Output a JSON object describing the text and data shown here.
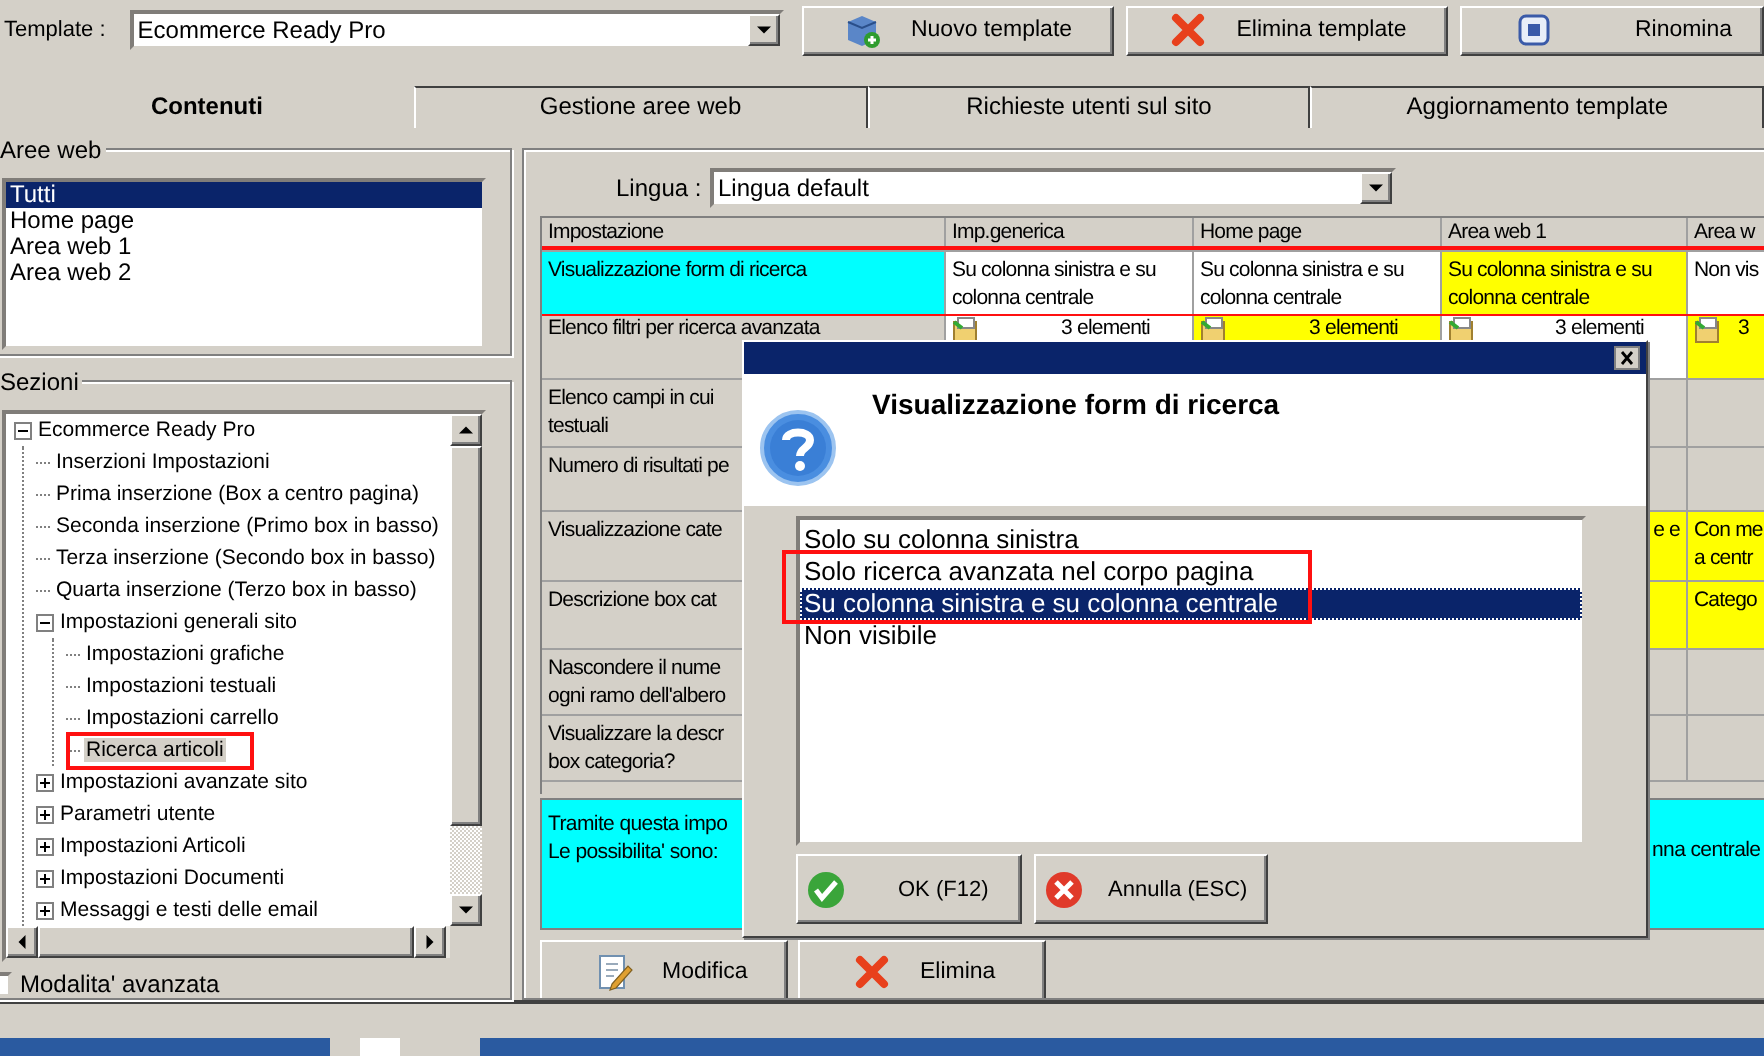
{
  "template": {
    "label": "Template :",
    "value": "Ecommerce Ready Pro"
  },
  "toolbar": [
    {
      "label": "Nuovo template"
    },
    {
      "label": "Elimina template"
    },
    {
      "label": "Rinomina"
    }
  ],
  "tabs": [
    {
      "label": "Contenuti",
      "selected": true
    },
    {
      "label": "Gestione aree web",
      "selected": false
    },
    {
      "label": "Richieste utenti sul sito",
      "selected": false
    },
    {
      "label": "Aggiornamento template",
      "selected": false
    }
  ],
  "aree_web": {
    "title": "Aree web",
    "items": [
      {
        "label": "Tutti",
        "selected": true
      },
      {
        "label": "Home page",
        "selected": false
      },
      {
        "label": "Area web 1",
        "selected": false
      },
      {
        "label": "Area web 2",
        "selected": false
      }
    ]
  },
  "sezioni": {
    "title": "Sezioni",
    "tree": [
      {
        "label": "Ecommerce Ready Pro",
        "expanded": true,
        "selected": false,
        "highlighted": false,
        "children": [
          {
            "label": "Inserzioni Impostazioni",
            "selected": false,
            "highlighted": false
          },
          {
            "label": "Prima inserzione (Box a centro pagina)",
            "selected": false,
            "highlighted": false
          },
          {
            "label": "Seconda inserzione (Primo box in basso)",
            "selected": false,
            "highlighted": false
          },
          {
            "label": "Terza inserzione (Secondo box in basso)",
            "selected": false,
            "highlighted": false
          },
          {
            "label": "Quarta inserzione (Terzo box in basso)",
            "selected": false,
            "highlighted": false
          },
          {
            "label": "Impostazioni generali sito",
            "expanded": true,
            "selected": false,
            "highlighted": false,
            "children": [
              {
                "label": "Impostazioni grafiche",
                "selected": false,
                "highlighted": false
              },
              {
                "label": "Impostazioni testuali",
                "selected": false,
                "highlighted": false
              },
              {
                "label": "Impostazioni carrello",
                "selected": false,
                "highlighted": false
              },
              {
                "label": "Ricerca articoli",
                "selected": true,
                "highlighted": true
              }
            ]
          },
          {
            "label": "Impostazioni avanzate sito",
            "expanded": false,
            "selected": false,
            "highlighted": false
          },
          {
            "label": "Parametri utente",
            "expanded": false,
            "selected": false,
            "highlighted": false
          },
          {
            "label": "Impostazioni Articoli",
            "expanded": false,
            "selected": false,
            "highlighted": false
          },
          {
            "label": "Impostazioni Documenti",
            "expanded": false,
            "selected": false,
            "highlighted": false
          },
          {
            "label": "Messaggi e testi delle email",
            "expanded": false,
            "selected": false,
            "highlighted": false
          }
        ]
      }
    ]
  },
  "advanced_mode": {
    "label": "Modalita' avanzata",
    "checked": false
  },
  "lingua": {
    "label": "Lingua :",
    "value": "Lingua default"
  },
  "grid": {
    "columns": [
      "Impostazione",
      "Imp.generica",
      "Home page",
      "Area web 1",
      "Area w"
    ],
    "rows": [
      {
        "highlighted": true,
        "cells": [
          {
            "text": "Visualizzazione form di ricerca",
            "color": "#00ffff"
          },
          {
            "text": "Su colonna sinistra e su colonna centrale",
            "color": "#ffffff"
          },
          {
            "text": "Su colonna sinistra e su colonna centrale",
            "color": "#ffffff"
          },
          {
            "text": "Su colonna sinistra e su colonna centrale",
            "color": "#ffff00"
          },
          {
            "text": "Non vis",
            "color": "#ffffff"
          }
        ]
      },
      {
        "highlighted": false,
        "cells": [
          {
            "text": "Elenco filtri per ricerca avanzata",
            "color": "#d4d0c8"
          },
          {
            "kind": "list",
            "text": "3 elementi",
            "color": "#ffffff"
          },
          {
            "kind": "list",
            "text": "3 elementi",
            "color": "#ffff00"
          },
          {
            "kind": "list",
            "text": "3 elementi",
            "color": "#ffffff"
          },
          {
            "kind": "list",
            "text": "3",
            "color": "#ffff00"
          }
        ]
      },
      {
        "highlighted": false,
        "cells": [
          {
            "text": "Elenco campi in cui\ntestuali",
            "color": "#d4d0c8"
          },
          null,
          null,
          null,
          null
        ]
      },
      {
        "highlighted": false,
        "cells": [
          {
            "text": "Numero di risultati pe",
            "color": "#d4d0c8"
          },
          null,
          null,
          null,
          null
        ]
      },
      {
        "highlighted": false,
        "cells": [
          {
            "text": "Visualizzazione cate",
            "color": "#d4d0c8"
          },
          null,
          null,
          {
            "text": "e e",
            "color": "#ffff00"
          },
          {
            "text": "Con me\na centr",
            "color": "#ffff00"
          }
        ]
      },
      {
        "highlighted": false,
        "cells": [
          {
            "text": "Descrizione box cat",
            "color": "#d4d0c8"
          },
          null,
          null,
          {
            "color": "#ffff00"
          },
          {
            "text": "Catego",
            "color": "#ffff00"
          }
        ]
      },
      {
        "highlighted": false,
        "cells": [
          {
            "text": "Nascondere il nume\nogni ramo dell'albero",
            "color": "#d4d0c8"
          },
          null,
          null,
          null,
          null
        ]
      },
      {
        "highlighted": false,
        "cells": [
          {
            "text": "Visualizzare la descr\nbox categoria?",
            "color": "#d4d0c8"
          },
          null,
          null,
          null,
          null
        ]
      }
    ]
  },
  "description": {
    "text": "Tramite questa impo\nLe possibilita' sono:",
    "tail": "nna centrale"
  },
  "actions": [
    {
      "label": "Modifica"
    },
    {
      "label": "Elimina"
    }
  ],
  "dialog": {
    "title": "Visualizzazione form di ricerca",
    "options": [
      {
        "label": "Solo su colonna sinistra",
        "selected": false,
        "highlighted": false
      },
      {
        "label": "Solo ricerca avanzata nel corpo pagina",
        "selected": false,
        "highlighted": true
      },
      {
        "label": "Su colonna sinistra e su colonna centrale",
        "selected": true,
        "highlighted": true
      },
      {
        "label": "Non visibile",
        "selected": false,
        "highlighted": false
      }
    ],
    "buttons": [
      {
        "label": "OK (F12)"
      },
      {
        "label": "Annulla (ESC)"
      }
    ]
  }
}
